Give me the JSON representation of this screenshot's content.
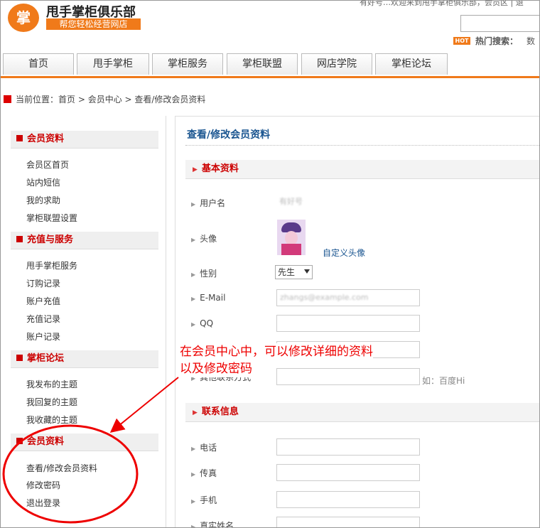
{
  "header": {
    "logo_char": "掌",
    "site_title": "甩手掌柜俱乐部",
    "slogan": "帮您轻松经营网店",
    "welcome": "有好号…欢迎来到甩手掌柜俱乐部，会员区 | 退",
    "hot_badge": "HOT",
    "hot_label": "热门搜索：",
    "hot_word": "数"
  },
  "nav": {
    "tabs": [
      "首页",
      "甩手掌柜",
      "掌柜服务",
      "掌柜联盟",
      "网店学院",
      "掌柜论坛"
    ]
  },
  "breadcrumb": {
    "prefix": "当前位置：",
    "path": "首页 > 会员中心 > 查看/修改会员资料"
  },
  "sidebar": {
    "sections": [
      {
        "title": "会员资料",
        "items": [
          "会员区首页",
          "站内短信",
          "我的求助",
          "掌柜联盟设置"
        ]
      },
      {
        "title": "充值与服务",
        "items": [
          "甩手掌柜服务",
          "订购记录",
          "账户充值",
          "充值记录",
          "账户记录"
        ]
      },
      {
        "title": "掌柜论坛",
        "items": [
          "我发布的主题",
          "我回复的主题",
          "我收藏的主题"
        ]
      },
      {
        "title": "会员资料",
        "items": [
          "查看/修改会员资料",
          "修改密码",
          "退出登录"
        ]
      }
    ]
  },
  "main": {
    "title": "查看/修改会员资料",
    "basic_section": "基本资料",
    "fields": {
      "username_label": "用户名",
      "username_value": "有好号",
      "avatar_label": "头像",
      "avatar_link": "自定义头像",
      "gender_label": "性别",
      "gender_value": "先生",
      "email_label": "E-Mail",
      "email_value": "zhangs@example.com",
      "qq_label": "QQ",
      "other_label": "其他联系方式",
      "other_hint": "如：百度Hi"
    },
    "contact_section": "联系信息",
    "contact_fields": {
      "phone_label": "电话",
      "fax_label": "传真",
      "mobile_label": "手机",
      "realname_label": "真实姓名"
    }
  },
  "annotation": {
    "line1": "在会员中心中，可以修改详细的资料",
    "line2": "以及修改密码",
    "color": "#e00000"
  }
}
